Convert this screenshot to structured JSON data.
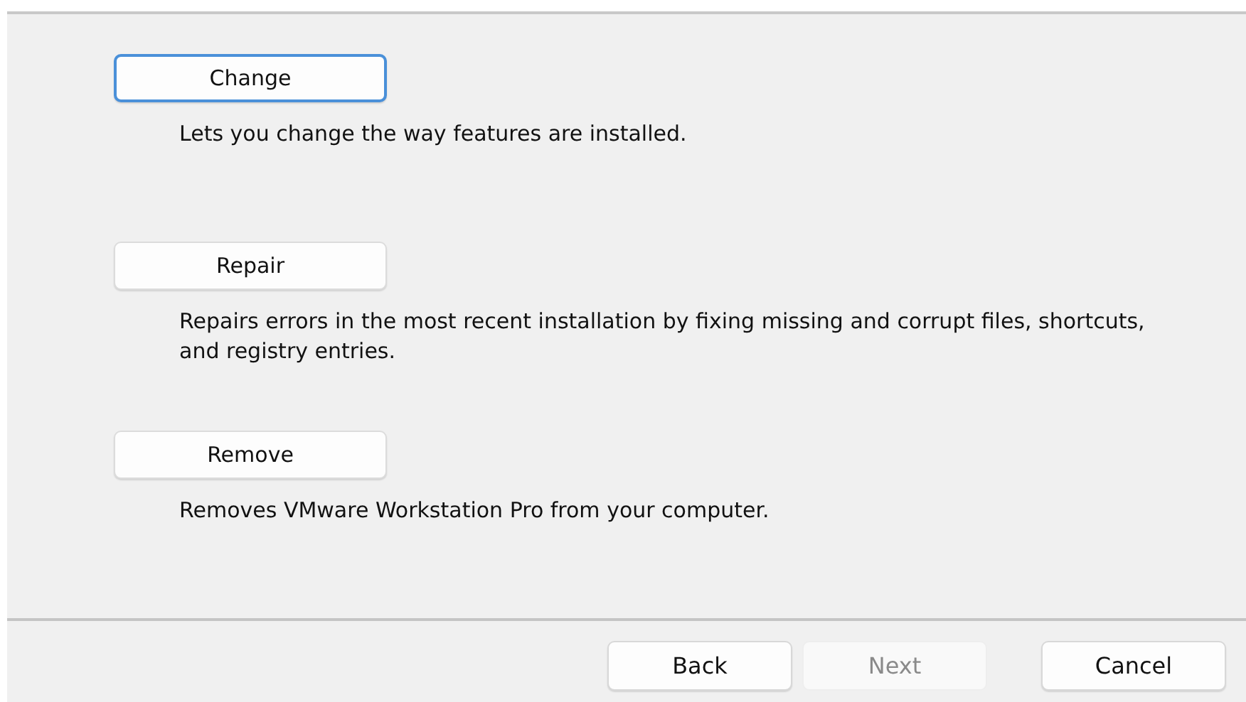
{
  "options": [
    {
      "label": "Change",
      "description": "Lets you change the way features are installed.",
      "focused": true
    },
    {
      "label": "Repair",
      "description": "Repairs errors in the most recent installation by fixing missing and corrupt files, shortcuts, and registry entries.",
      "focused": false
    },
    {
      "label": "Remove",
      "description": "Removes VMware Workstation Pro from your computer.",
      "focused": false
    }
  ],
  "buttons": [
    {
      "label": "Back",
      "disabled": false
    },
    {
      "label": "Next",
      "disabled": true
    },
    {
      "label": "Cancel",
      "disabled": false
    }
  ]
}
